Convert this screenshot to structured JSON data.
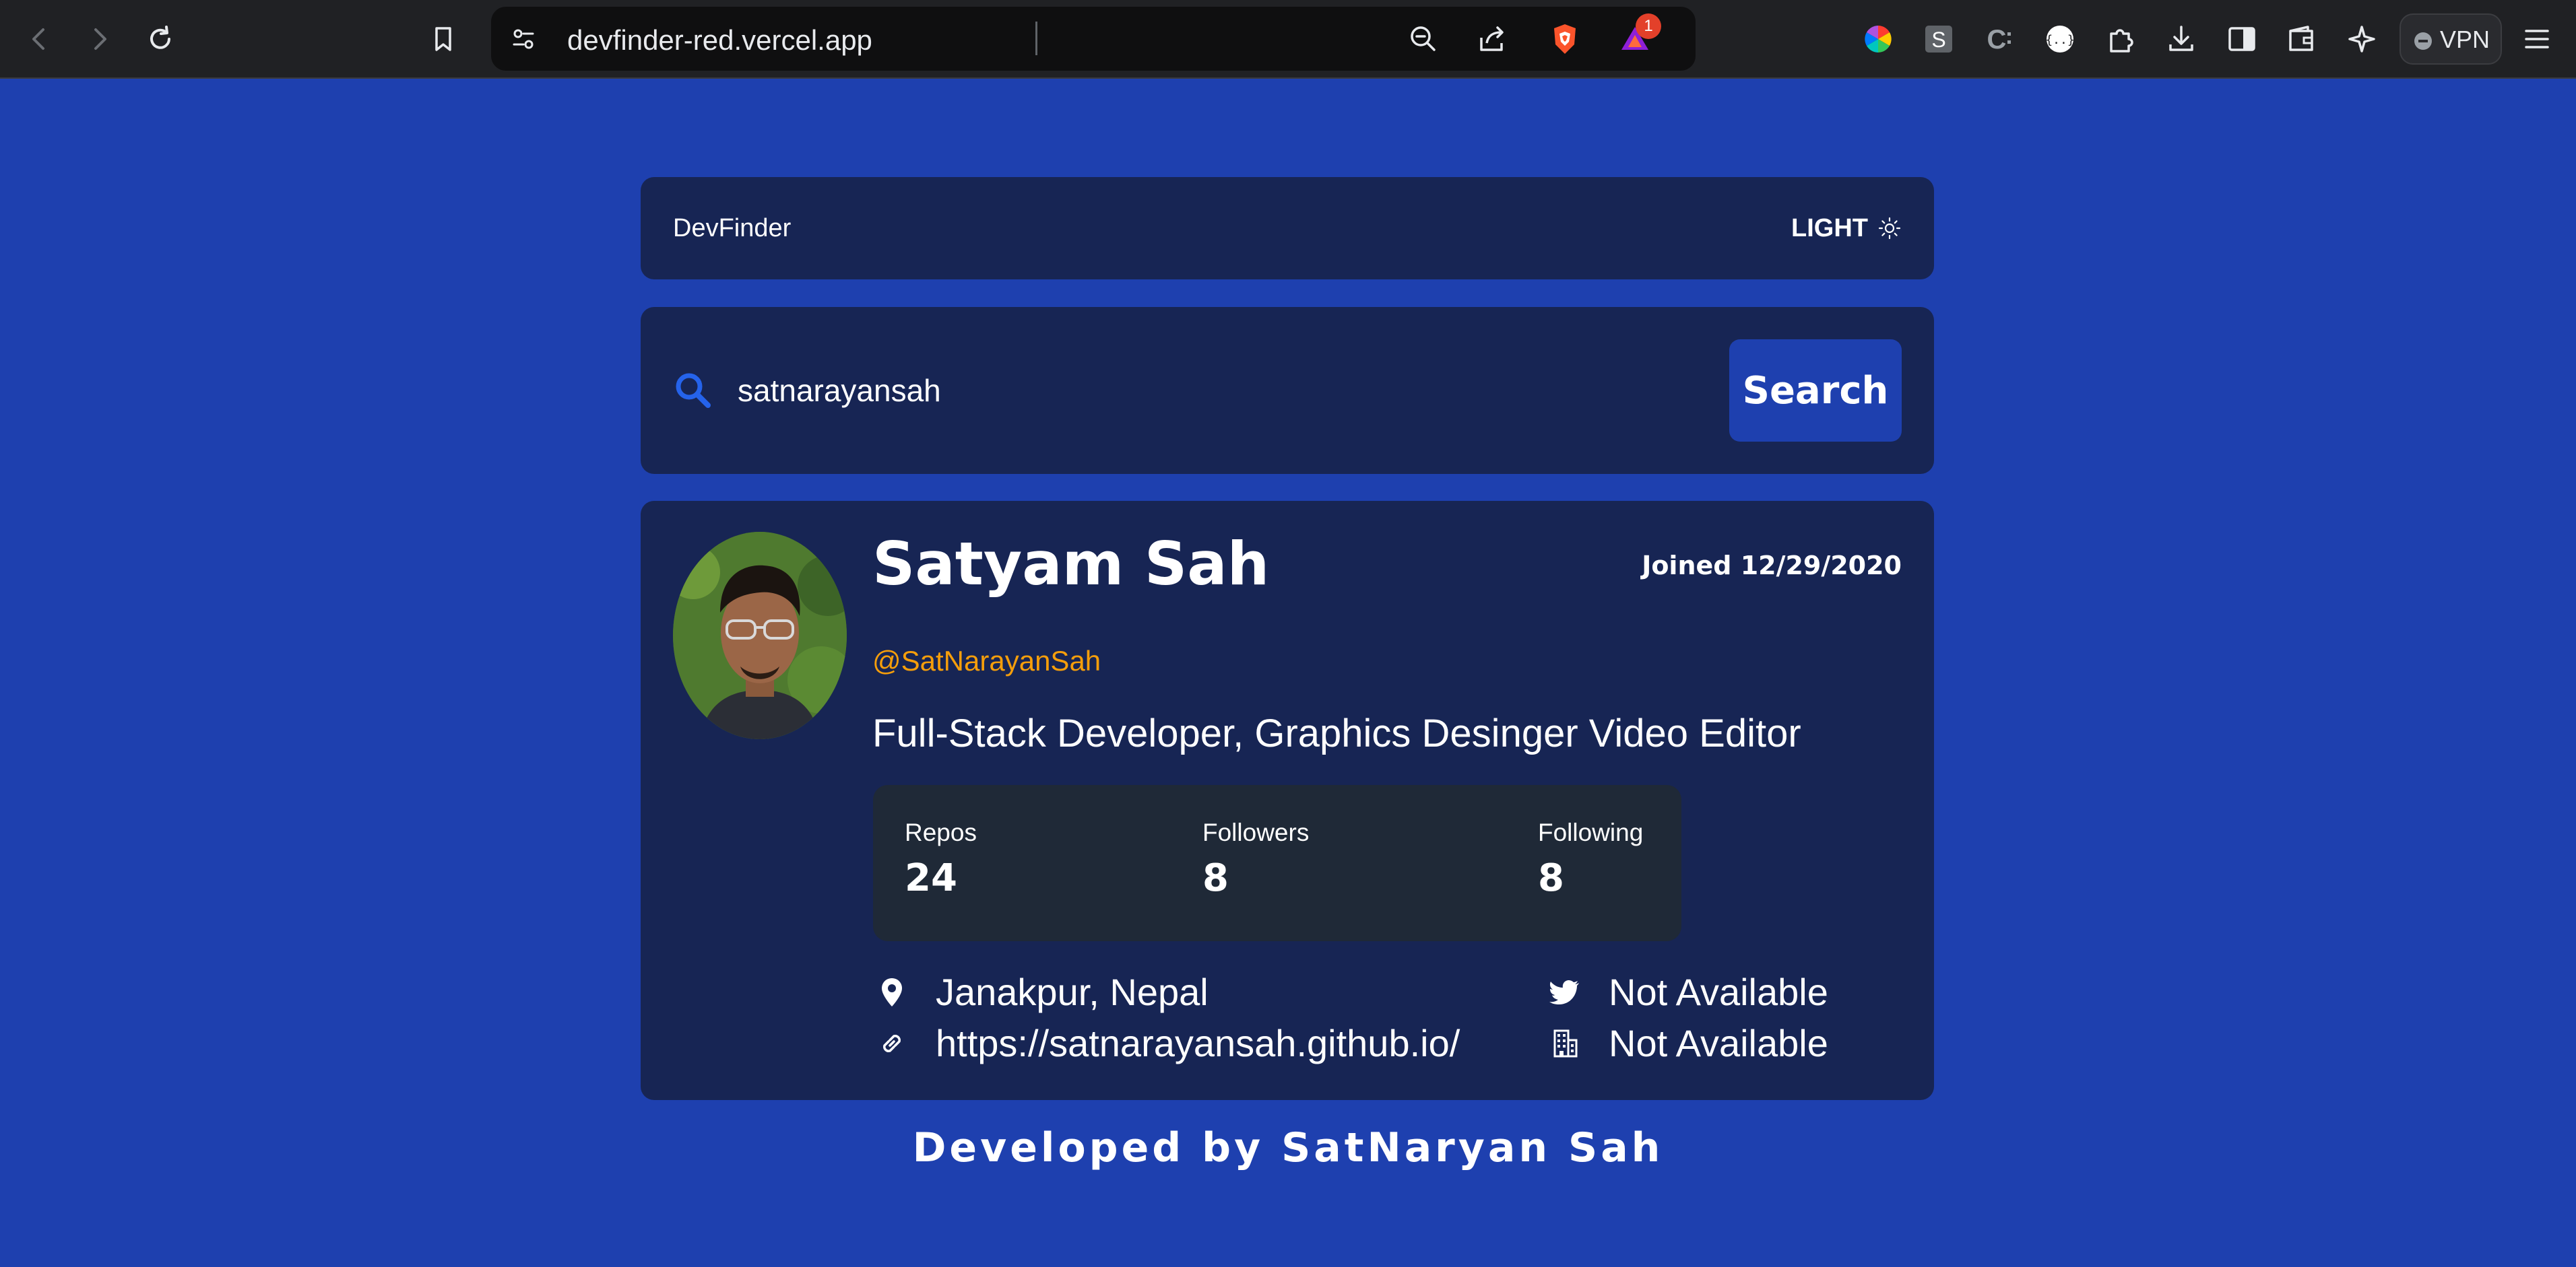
{
  "browser": {
    "url": "devfinder-red.vercel.app",
    "notification_count": "1",
    "vpn_label": "VPN"
  },
  "app": {
    "brand": "DevFinder",
    "theme_toggle_label": "LIGHT"
  },
  "search": {
    "value": "satnarayansah",
    "button_label": "Search"
  },
  "profile": {
    "name": "Satyam Sah",
    "joined": "Joined 12/29/2020",
    "handle": "@SatNarayanSah",
    "bio": "Full-Stack Developer, Graphics Desinger Video Editor",
    "stats": {
      "repos_label": "Repos",
      "repos_value": "24",
      "followers_label": "Followers",
      "followers_value": "8",
      "following_label": "Following",
      "following_value": "8"
    },
    "location": "Janakpur, Nepal",
    "website": "https://satnarayansah.github.io/",
    "twitter": "Not Available",
    "company": "Not Available"
  },
  "footer": {
    "text": "Developed by SatNaryan Sah"
  },
  "colors": {
    "page_background": "#1e40af",
    "card_background": "#172554",
    "stats_background": "#1f2937",
    "accent_blue": "#2563eb",
    "handle_color": "#f59e0b"
  }
}
